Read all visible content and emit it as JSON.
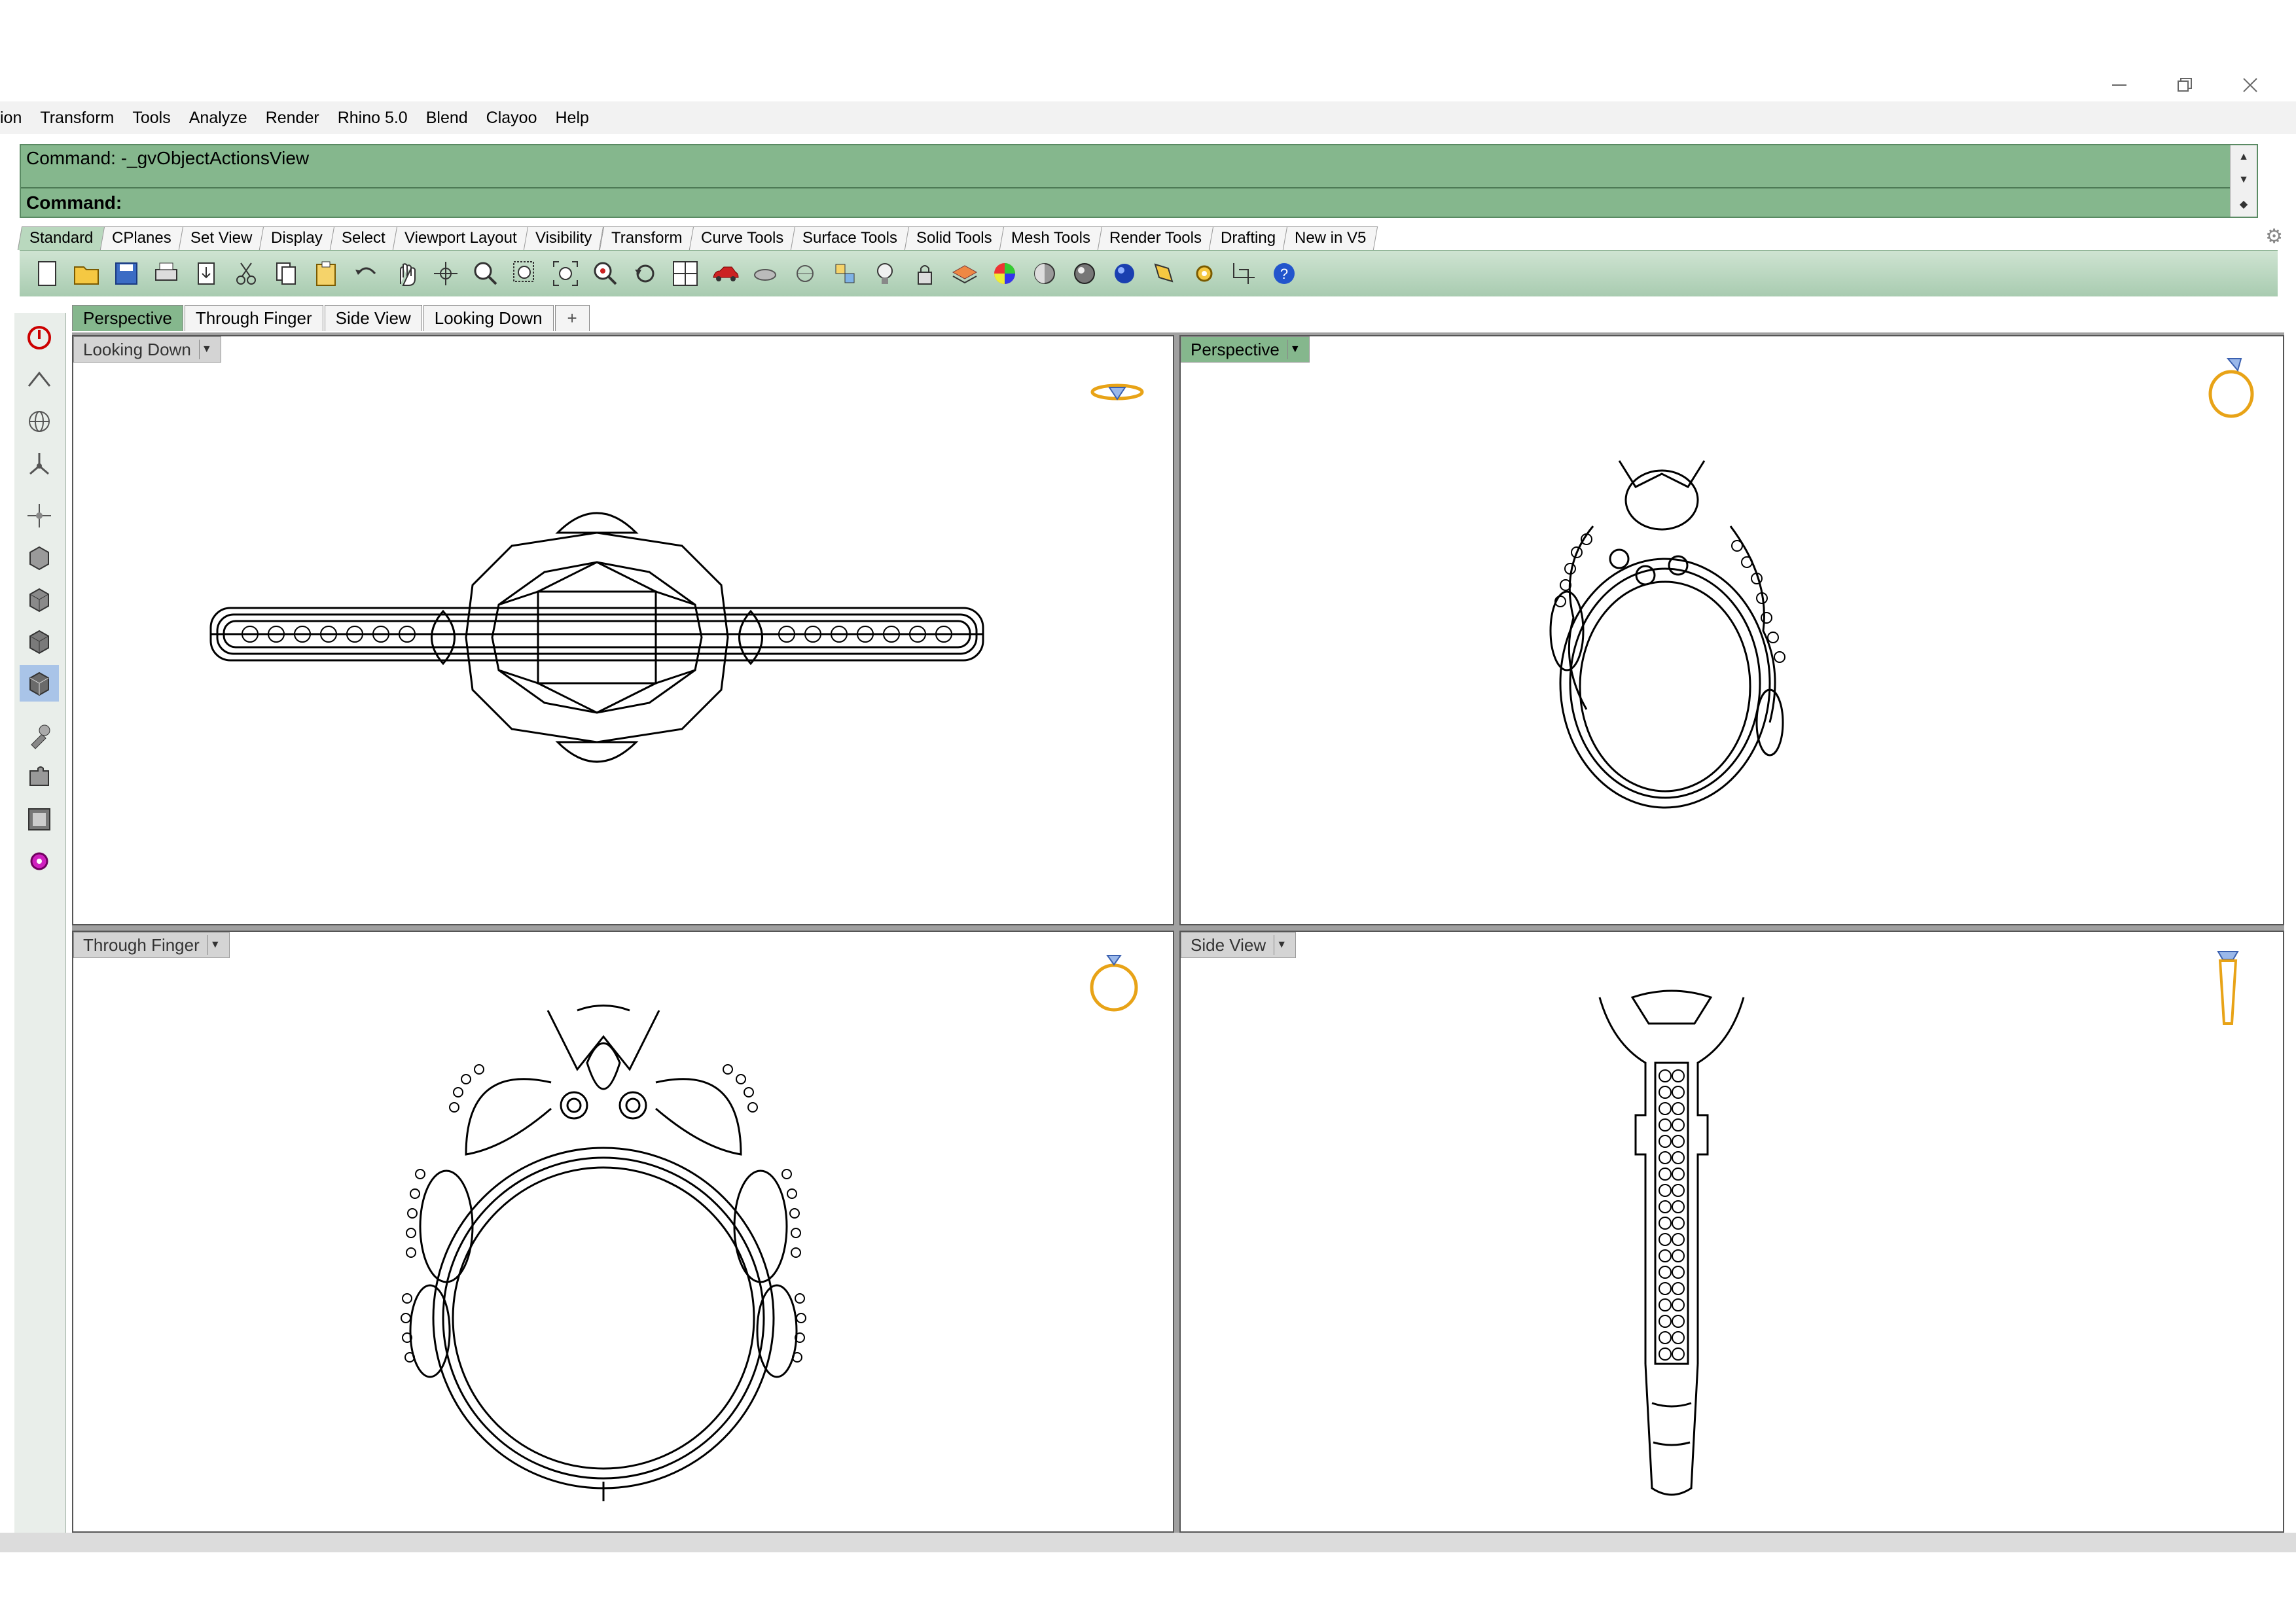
{
  "window": {
    "controls": [
      "minimize-icon",
      "restore-icon",
      "close-icon"
    ]
  },
  "menubar": {
    "items": [
      "ion",
      "Transform",
      "Tools",
      "Analyze",
      "Render",
      "Rhino 5.0",
      "Blend",
      "Clayoo",
      "Help"
    ]
  },
  "command": {
    "history": "Command: -_gvObjectActionsView",
    "prompt": "Command:"
  },
  "toolbar_tabs": [
    {
      "label": "Standard",
      "active": true
    },
    {
      "label": "CPlanes"
    },
    {
      "label": "Set View"
    },
    {
      "label": "Display"
    },
    {
      "label": "Select"
    },
    {
      "label": "Viewport Layout"
    },
    {
      "label": "Visibility"
    },
    {
      "label": "Transform"
    },
    {
      "label": "Curve Tools"
    },
    {
      "label": "Surface Tools"
    },
    {
      "label": "Solid Tools"
    },
    {
      "label": "Mesh Tools"
    },
    {
      "label": "Render Tools"
    },
    {
      "label": "Drafting"
    },
    {
      "label": "New in V5"
    }
  ],
  "toolbar_icons": [
    "new-icon",
    "open-icon",
    "save-icon",
    "print-icon",
    "import-icon",
    "cut-icon",
    "copy-icon",
    "paste-icon",
    "undo-icon",
    "pan-icon",
    "rotate-icon",
    "zoom-icon",
    "zoom-window-icon",
    "zoom-extents-icon",
    "zoom-selected-icon",
    "undo-view-icon",
    "viewport-layout-icon",
    "car-icon",
    "hide-icon",
    "show-icon",
    "points-icon",
    "light-icon",
    "lock-icon",
    "layer-icon",
    "color-wheel-icon",
    "shade-icon",
    "render-preview-icon",
    "render-icon",
    "pen-icon",
    "options-icon",
    "grid-icon",
    "help-icon"
  ],
  "left_toolbar_icons": [
    "power-icon",
    "plane-icon",
    "globe-icon",
    "axes-icon",
    "gumball-icon",
    "box-top-icon",
    "box-front-icon",
    "box-right-icon",
    "box-perspective-icon",
    "brush-icon",
    "puzzle-icon",
    "frame-icon",
    "gear-pink-icon"
  ],
  "viewport_tabs": [
    {
      "label": "Perspective",
      "active": true
    },
    {
      "label": "Through Finger"
    },
    {
      "label": "Side View"
    },
    {
      "label": "Looking Down"
    },
    {
      "label": "+"
    }
  ],
  "viewports": {
    "top_left": {
      "label": "Looking Down"
    },
    "top_right": {
      "label": "Perspective"
    },
    "bottom_left": {
      "label": "Through Finger"
    },
    "bottom_right": {
      "label": "Side View"
    }
  },
  "colors": {
    "command_bg": "#85b78d",
    "active_tab": "#85b78d",
    "icon_gold": "#e8a317"
  }
}
